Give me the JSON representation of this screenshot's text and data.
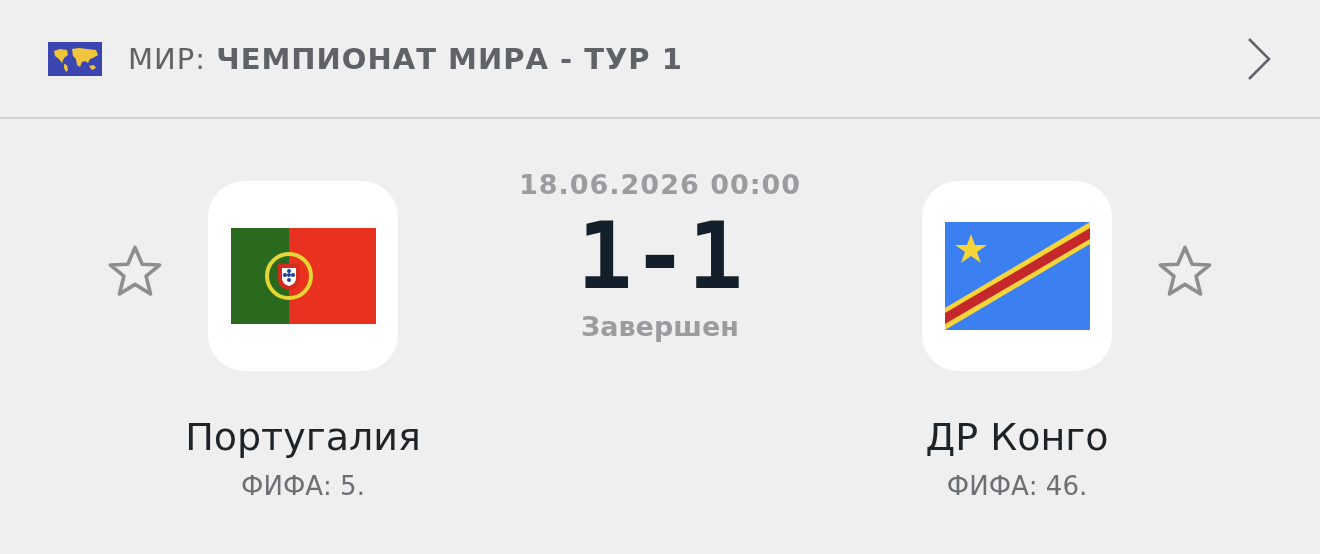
{
  "header": {
    "region": "МИР:",
    "tournament": "ЧЕМПИОНАТ МИРА - ТУР 1"
  },
  "match": {
    "date": "18.06.2026 00:00",
    "score": "1-1",
    "status": "Завершен"
  },
  "teams": [
    {
      "name": "Португалия",
      "rating": "ФИФА: 5.",
      "kind": "portugal",
      "favorite": false
    },
    {
      "name": "ДР Конго",
      "rating": "ФИФА: 46.",
      "kind": "drc",
      "favorite": false
    }
  ]
}
